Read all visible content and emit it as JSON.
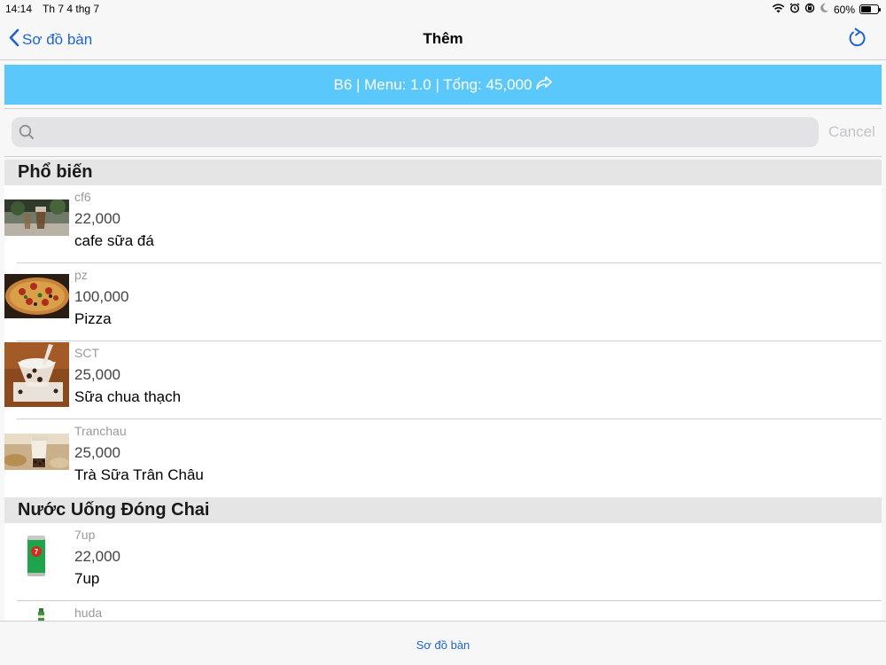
{
  "status": {
    "time": "14:14",
    "date": "Th 7 4 thg 7",
    "battery": "60%",
    "battery_level": 0.6
  },
  "nav": {
    "back_label": "Sơ đồ bàn",
    "title": "Thêm",
    "accent": "#1e63d6"
  },
  "banner": {
    "text": "B6 | Menu: 1.0 | Tổng: 45,000",
    "color": "#5ac8fa"
  },
  "search": {
    "placeholder": "",
    "value": "",
    "cancel_label": "Cancel"
  },
  "sections": [
    {
      "title": "Phổ biến",
      "items": [
        {
          "code": "cf6",
          "price": "22,000",
          "name": "cafe sữa đá",
          "image": "iced-coffee-photo"
        },
        {
          "code": "pz",
          "price": "100,000",
          "name": "Pizza",
          "image": "pizza-photo"
        },
        {
          "code": "SCT",
          "price": "25,000",
          "name": "Sữa chua thạch",
          "image": "yogurt-jelly-photo"
        },
        {
          "code": "Tranchau",
          "price": "25,000",
          "name": "Trà Sữa Trân Châu",
          "image": "bubble-tea-photo"
        }
      ]
    },
    {
      "title": "Nước Uống Đóng Chai",
      "items": [
        {
          "code": "7up",
          "price": "22,000",
          "name": "7up",
          "image": "7up-can-photo"
        },
        {
          "code": "huda",
          "price": "",
          "name": "",
          "image": "huda-bottle-photo"
        }
      ]
    }
  ],
  "tabbar": {
    "label": "Sơ đồ bàn"
  }
}
